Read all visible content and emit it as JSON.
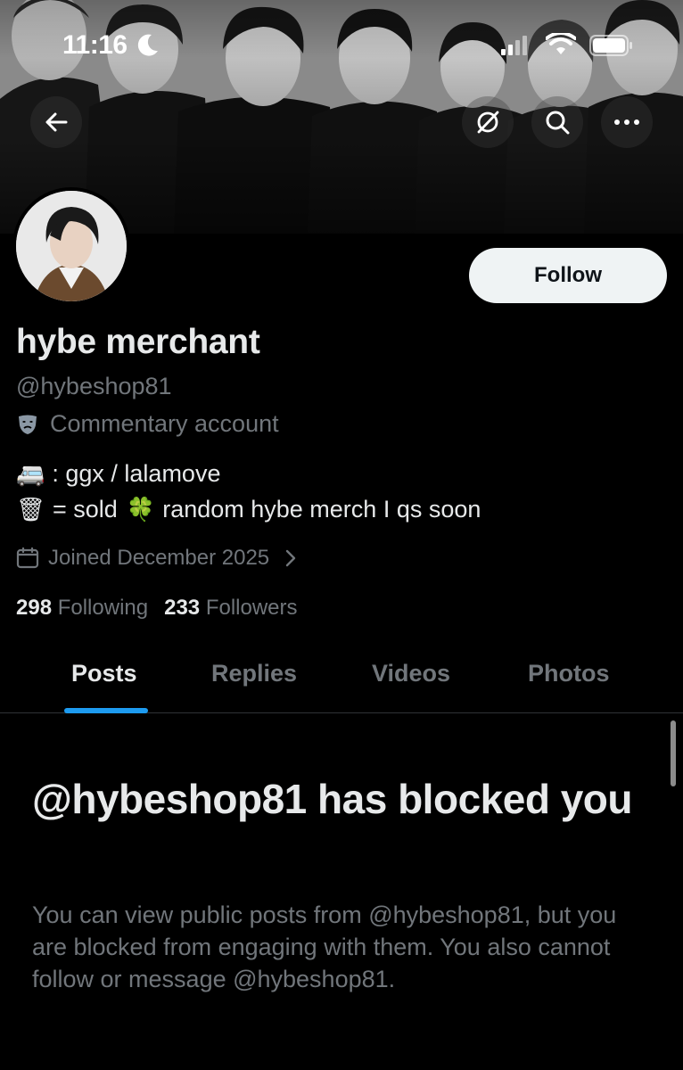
{
  "status_bar": {
    "time": "11:16"
  },
  "header": {
    "icons": [
      "arrow-left-icon",
      "translate-icon",
      "search-icon",
      "more-icon"
    ]
  },
  "profile": {
    "display_name": "hybe merchant",
    "handle": "@hybeshop81",
    "label": "Commentary account",
    "label_icon": "mask-icon",
    "bio": {
      "line1_emoji": "🚐",
      "line1_text": ": ggx / lalamove",
      "line2_emoji": "🗑",
      "line2_text_a": "= sold",
      "line2_emoji_b": "🍀",
      "line2_text_b": "random hybe merch I qs soon"
    },
    "joined": "Joined December 2025",
    "following_count": "298",
    "following_label": "Following",
    "followers_count": "233",
    "followers_label": "Followers",
    "follow_button_label": "Follow"
  },
  "tabs": [
    {
      "label": "Posts",
      "active": true
    },
    {
      "label": "Replies",
      "active": false
    },
    {
      "label": "Videos",
      "active": false
    },
    {
      "label": "Photos",
      "active": false
    }
  ],
  "blocked_notice": {
    "title": "@hybeshop81 has blocked you",
    "body": "You can view public posts from @hybeshop81, but you are blocked from engaging with them. You also cannot follow or message @hybeshop81."
  },
  "colors": {
    "background": "#000000",
    "text_primary": "#e7e9ea",
    "text_secondary": "#71767b",
    "accent": "#1d9bf0",
    "follow_button_bg": "#eff3f4"
  }
}
